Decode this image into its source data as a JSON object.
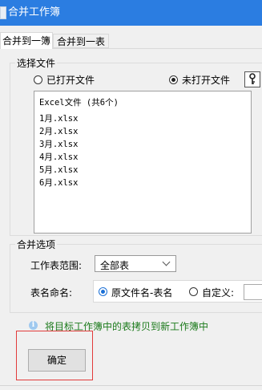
{
  "window": {
    "title": "合并工作簿"
  },
  "tabs": [
    {
      "label": "合并到一簿",
      "active": true
    },
    {
      "label": "合并到一表",
      "active": false
    }
  ],
  "select_files": {
    "legend": "选择文件",
    "options": [
      {
        "label": "已打开文件",
        "selected": false
      },
      {
        "label": "未打开文件",
        "selected": true
      }
    ],
    "key_icon": "key-icon",
    "list_header": "Excel文件 (共6个)",
    "files": [
      "1月.xlsx",
      "2月.xlsx",
      "3月.xlsx",
      "4月.xlsx",
      "5月.xlsx",
      "6月.xlsx"
    ]
  },
  "merge_options": {
    "legend": "合并选项",
    "range_label": "工作表范围:",
    "range_value": "全部表",
    "naming_label": "表名命名:",
    "naming_options": [
      {
        "label": "原文件名-表名",
        "selected": true
      },
      {
        "label": "自定义:",
        "selected": false
      }
    ]
  },
  "hint": {
    "icon": "info-icon",
    "text": "将目标工作簿中的表拷贝到新工作簿中"
  },
  "ok_button": "确定",
  "colors": {
    "titlebar": "#2b7de1",
    "hint_text": "#1b7a1b",
    "highlight_box": "#e23b3b"
  }
}
